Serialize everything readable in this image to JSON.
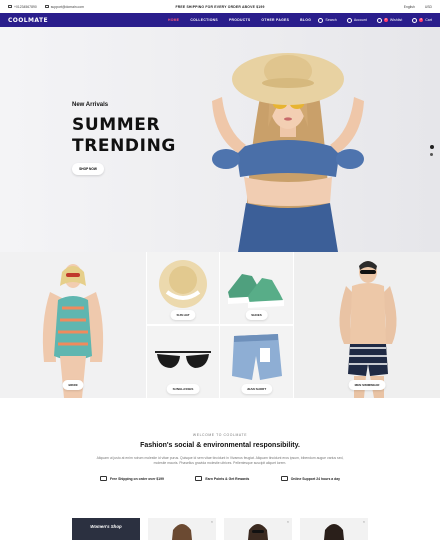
{
  "topbar": {
    "phone": "+01234567890",
    "email": "support@domain.com",
    "promo": "FREE SHIPPING FOR EVERY ORDER ABOVE $199",
    "language": "English",
    "currency": "USD"
  },
  "nav": {
    "logo": "COOLMATE",
    "menu": [
      {
        "label": "HOME",
        "active": true
      },
      {
        "label": "COLLECTIONS",
        "active": false
      },
      {
        "label": "PRODUCTS",
        "active": false
      },
      {
        "label": "OTHER PAGES",
        "active": false
      },
      {
        "label": "BLOG",
        "active": false
      }
    ],
    "search": "Search",
    "account": "Account",
    "wishlist": "Wishlist",
    "cart": "Cart",
    "wishlist_count": "0",
    "cart_count": "0"
  },
  "hero": {
    "subtitle": "New Arrivals",
    "title_line1": "SUMMER",
    "title_line2": "TRENDING",
    "button": "SHOP NOW"
  },
  "categories": [
    {
      "label": "BIKINI"
    },
    {
      "label": "SUN HAT"
    },
    {
      "label": "SHOES"
    },
    {
      "label": "SUNGLASSES"
    },
    {
      "label": "JEAN SHORT"
    },
    {
      "label": "MEN SWIMWEAR"
    }
  ],
  "welcome": {
    "eyebrow": "WELCOME TO COOLMATE",
    "heading": "Fashion's social & environmental responsibility.",
    "text": "Aliquam ut justo at enim rutrum molestie id vitae purus. Quisque id sem vitae tincidunt in Vivamus feugiat. Aliquam tincidunt eros ipsum, bibendum augue varius sed, molestie mauris. Phasellus gravida molestie ultrices. Pellentesque suscipit aliquet lorem.",
    "features": [
      {
        "icon": "truck-icon",
        "label": "Free Shipping on order over $199"
      },
      {
        "icon": "gift-icon",
        "label": "Earn Points & Get Rewards"
      },
      {
        "icon": "phone-icon",
        "label": "Online Support 24 hours a day"
      }
    ]
  },
  "products": {
    "first_label": "Women's Shop"
  },
  "colors": {
    "nav_bg": "#2a1e8c",
    "active_menu": "#ff5a7a",
    "badge": "#ff3b6b"
  }
}
